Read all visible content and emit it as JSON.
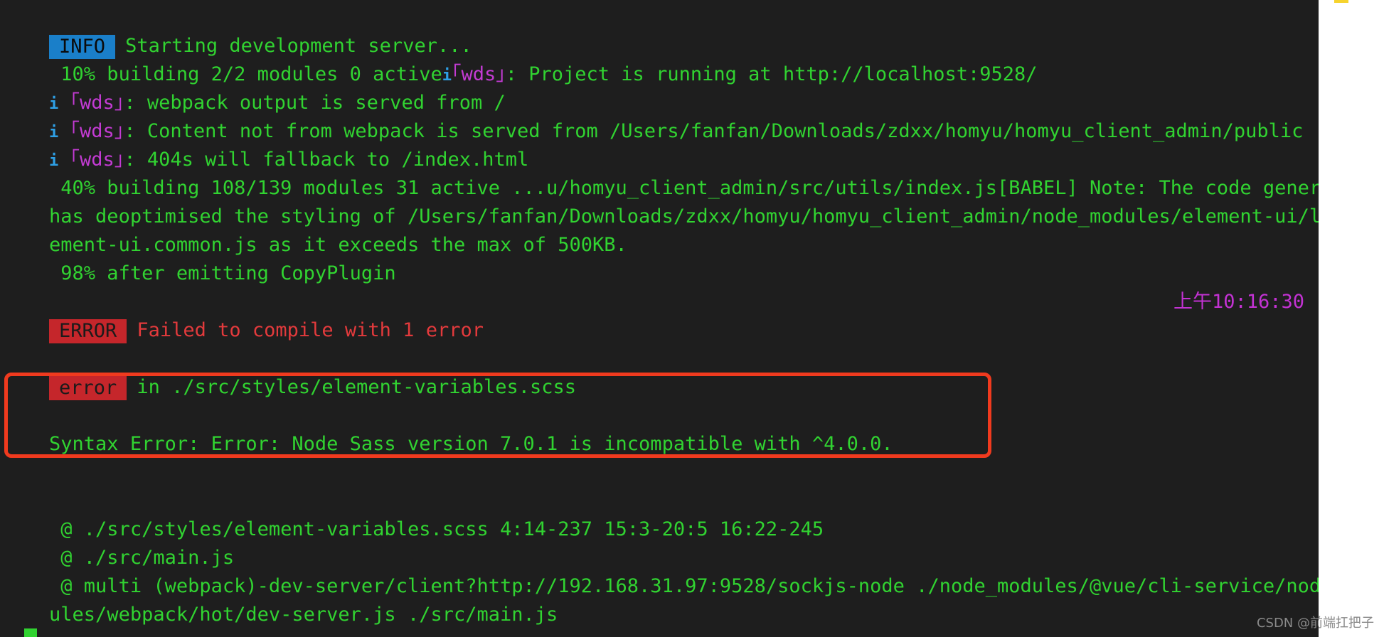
{
  "terminal": {
    "lines": {
      "l1": {
        "badge": "INFO",
        "text": "Starting development server..."
      },
      "l2": {
        "prefix": " 10% building 2/2 modules 0 active",
        "icon": "i",
        "tag": "｢wds｣",
        "text": ": Project is running at http://localhost:9528/"
      },
      "l3": {
        "icon": "i",
        "tag": " ｢wds｣",
        "text": ": webpack output is served from /"
      },
      "l4": {
        "icon": "i",
        "tag": " ｢wds｣",
        "text": ": Content not from webpack is served from /Users/fanfan/Downloads/zdxx/homyu/homyu_client_admin/public"
      },
      "l5": {
        "icon": "i",
        "tag": " ｢wds｣",
        "text": ": 404s will fallback to /index.html"
      },
      "l6": {
        "text": " 40% building 108/139 modules 31 active ...u/homyu_client_admin/src/utils/index.js[BABEL] Note: The code generator"
      },
      "l7": {
        "text": "has deoptimised the styling of /Users/fanfan/Downloads/zdxx/homyu/homyu_client_admin/node_modules/element-ui/lib/el"
      },
      "l8": {
        "text": "ement-ui.common.js as it exceeds the max of 500KB."
      },
      "l9": {
        "text": " 98% after emitting CopyPlugin"
      },
      "l10": {
        "badge": "ERROR",
        "text": "Failed to compile with 1 error",
        "timestamp": "上午10:16:30"
      },
      "l11": {
        "badge": "error",
        "text": "in ./src/styles/element-variables.scss"
      },
      "l12": {
        "text": "Syntax Error: Error: Node Sass version 7.0.1 is incompatible with ^4.0.0."
      },
      "l13": {
        "text": " @ ./src/styles/element-variables.scss 4:14-237 15:3-20:5 16:22-245"
      },
      "l14": {
        "text": " @ ./src/main.js"
      },
      "l15": {
        "text": " @ multi (webpack)-dev-server/client?http://192.168.31.97:9528/sockjs-node ./node_modules/@vue/cli-service/node_mod"
      },
      "l16": {
        "text": "ules/webpack/hot/dev-server.js ./src/main.js"
      }
    },
    "colors": {
      "text": "#31d331",
      "magenta": "#c33bd3",
      "error": "#e33a3c",
      "info_badge": "#1a7fc9",
      "error_badge": "#c5262b",
      "highlight_box": "#f03a1e"
    }
  },
  "watermark": "CSDN @前端扛把子"
}
